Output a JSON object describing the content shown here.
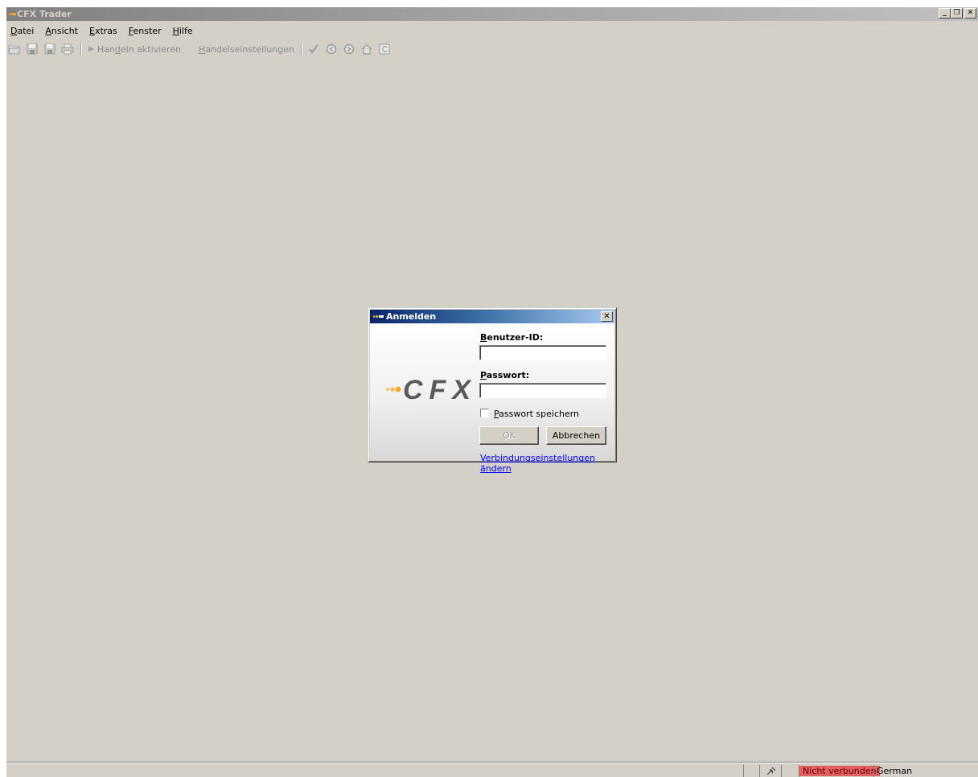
{
  "window": {
    "title": "CFX Trader"
  },
  "menu": [
    {
      "pre": "",
      "u": "D",
      "post": "atei"
    },
    {
      "pre": "",
      "u": "A",
      "post": "nsicht"
    },
    {
      "pre": "",
      "u": "E",
      "post": "xtras"
    },
    {
      "pre": "",
      "u": "F",
      "post": "enster"
    },
    {
      "pre": "",
      "u": "H",
      "post": "ilfe"
    }
  ],
  "toolbar": {
    "activate": {
      "pre": "Han",
      "u": "d",
      "post": "eln aktivieren"
    },
    "settings": {
      "pre": "",
      "u": "H",
      "post": "andelseinstellungen"
    }
  },
  "dialog": {
    "title": "Anmelden",
    "logo_text": "CFX",
    "user_label": {
      "u": "B",
      "post": "enutzer-ID:"
    },
    "user_value": "",
    "pass_label": {
      "u": "P",
      "post": "asswort:"
    },
    "pass_value": "",
    "remember": {
      "u": "P",
      "post": "asswort speichern",
      "checked": false
    },
    "ok_label": "OK",
    "cancel_label": "Abbrechen",
    "link_text": "Verbindungseinstellungen ändern"
  },
  "statusbar": {
    "connection": "Nicht verbunden",
    "language": "German"
  },
  "colors": {
    "workspace": "#d4d0c8",
    "dialog_title_start": "#0a246a",
    "dialog_title_end": "#a6caf0",
    "logo_orange": "#f5a623",
    "logo_gray": "#5a5a5a",
    "status_red": "#e06060"
  }
}
